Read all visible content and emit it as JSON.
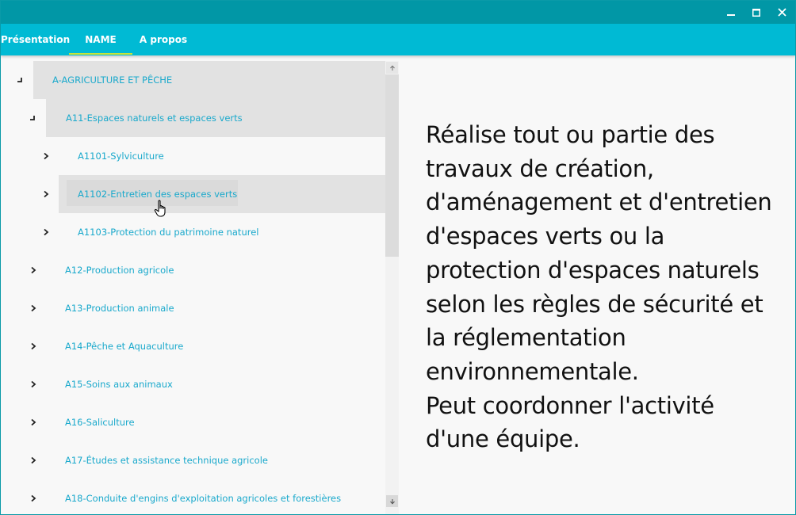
{
  "window": {
    "controls": {
      "minimize_icon": "minimize-icon",
      "maximize_icon": "maximize-icon",
      "close_icon": "close-icon"
    }
  },
  "tabs": [
    {
      "label": "Présentation"
    },
    {
      "label": "NAME",
      "selected": true
    },
    {
      "label": "A propos"
    }
  ],
  "colors": {
    "titlebar": "#0197a6",
    "tabbar": "#00bad4",
    "tab_indicator": "#c6e33a",
    "tree_link": "#1aa9cc",
    "selected_row": "#e2e2e2"
  },
  "tree": {
    "root": {
      "label": "A-AGRICULTURE ET PÊCHE",
      "expanded": true,
      "children": [
        {
          "label": "A11-Espaces naturels et espaces verts",
          "expanded": true,
          "children": [
            {
              "label": "A1101-Sylviculture"
            },
            {
              "label": "A1102-Entretien des espaces verts",
              "hovered": true
            },
            {
              "label": "A1103-Protection du patrimoine naturel"
            }
          ]
        },
        {
          "label": "A12-Production agricole"
        },
        {
          "label": "A13-Production animale"
        },
        {
          "label": "A14-Pêche et Aquaculture"
        },
        {
          "label": "A15-Soins aux animaux"
        },
        {
          "label": "A16-Saliculture"
        },
        {
          "label": "A17-Études et assistance technique agricole"
        },
        {
          "label": "A18-Conduite d'engins d'exploitation agricoles et forestières"
        }
      ]
    }
  },
  "description": {
    "text": "Réalise tout ou partie des\ntravaux de création,\nd'aménagement et d'entretien\nd'espaces verts ou la\nprotection d'espaces naturels\nselon les règles de sécurité et\nla réglementation\nenvironnementale.\nPeut coordonner l'activité\nd'une équipe."
  }
}
